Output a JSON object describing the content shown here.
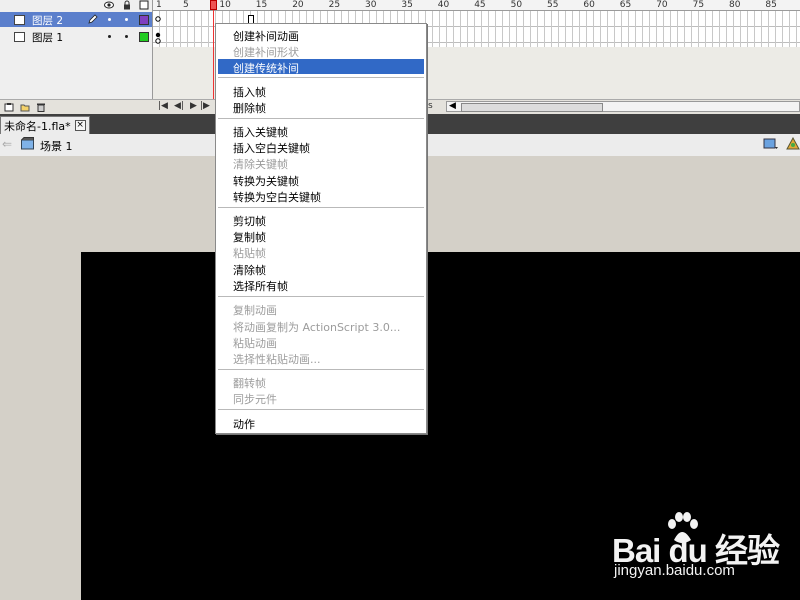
{
  "timeline": {
    "layers": [
      {
        "name": "图层 2",
        "color": "#7f3fbf",
        "selected": true
      },
      {
        "name": "图层 1",
        "color": "#22cc22",
        "selected": false
      }
    ],
    "ruler_ticks": [
      "1",
      "5",
      "10",
      "15",
      "20",
      "25",
      "30",
      "35",
      "40",
      "45",
      "50",
      "55",
      "60",
      "65",
      "70",
      "75",
      "80",
      "85"
    ],
    "footer_partial_text": "s"
  },
  "document_tab": {
    "title": "未命名-1.fla*",
    "close_label": "×"
  },
  "scene": {
    "name": "场景 1"
  },
  "context_menu": {
    "items": [
      {
        "label": "创建补间动画",
        "disabled": false,
        "selected": false
      },
      {
        "label": "创建补间形状",
        "disabled": true,
        "selected": false
      },
      {
        "label": "创建传统补间",
        "disabled": false,
        "selected": true
      },
      {
        "label": "插入帧",
        "disabled": false,
        "selected": false
      },
      {
        "label": "删除帧",
        "disabled": false,
        "selected": false
      },
      {
        "label": "插入关键帧",
        "disabled": false,
        "selected": false
      },
      {
        "label": "插入空白关键帧",
        "disabled": false,
        "selected": false
      },
      {
        "label": "清除关键帧",
        "disabled": true,
        "selected": false
      },
      {
        "label": "转换为关键帧",
        "disabled": false,
        "selected": false
      },
      {
        "label": "转换为空白关键帧",
        "disabled": false,
        "selected": false
      },
      {
        "label": "剪切帧",
        "disabled": false,
        "selected": false
      },
      {
        "label": "复制帧",
        "disabled": false,
        "selected": false
      },
      {
        "label": "粘贴帧",
        "disabled": true,
        "selected": false
      },
      {
        "label": "清除帧",
        "disabled": false,
        "selected": false
      },
      {
        "label": "选择所有帧",
        "disabled": false,
        "selected": false
      },
      {
        "label": "复制动画",
        "disabled": true,
        "selected": false
      },
      {
        "label": "将动画复制为 ActionScript 3.0...",
        "disabled": true,
        "selected": false
      },
      {
        "label": "粘贴动画",
        "disabled": true,
        "selected": false
      },
      {
        "label": "选择性粘贴动画...",
        "disabled": true,
        "selected": false
      },
      {
        "label": "翻转帧",
        "disabled": true,
        "selected": false
      },
      {
        "label": "同步元件",
        "disabled": true,
        "selected": false
      },
      {
        "label": "动作",
        "disabled": false,
        "selected": false
      }
    ]
  },
  "watermark": {
    "brand": "Bai du 经验",
    "url": "jingyan.baidu.com"
  }
}
